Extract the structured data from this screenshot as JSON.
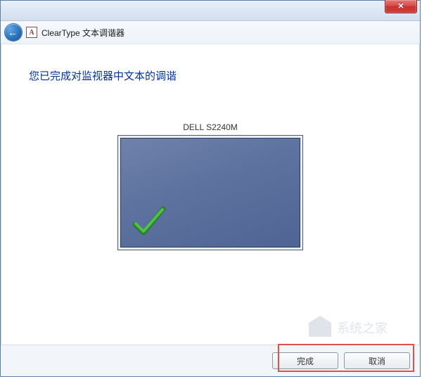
{
  "titlebar": {
    "app_icon_letter": "A",
    "title": "ClearType 文本调谐器"
  },
  "content": {
    "heading": "您已完成对监视器中文本的调谐",
    "monitor_name": "DELL S2240M"
  },
  "footer": {
    "finish_label": "完成",
    "cancel_label": "取消"
  },
  "watermark": {
    "text": "系统之家"
  },
  "colors": {
    "heading": "#003399",
    "close_bg": "#c83330",
    "screen_bg": "#5e739f",
    "check": "#3fa83f"
  }
}
